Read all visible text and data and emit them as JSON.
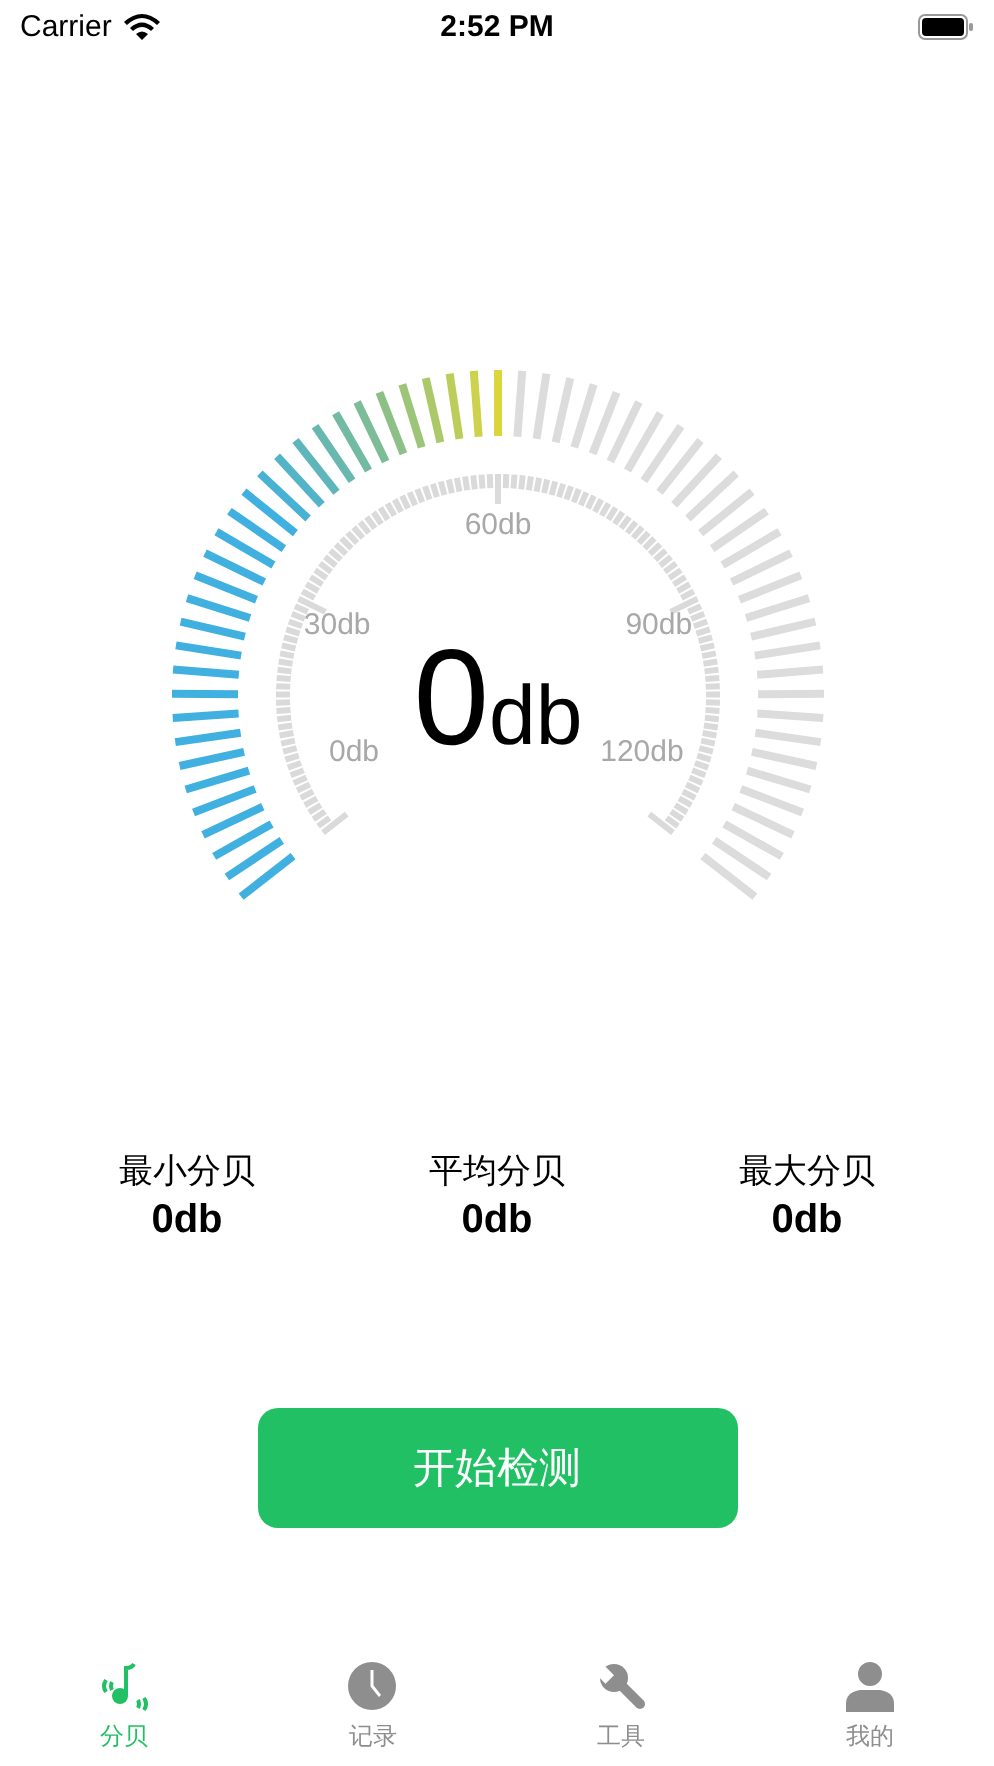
{
  "status_bar": {
    "carrier": "Carrier",
    "time": "2:52 PM"
  },
  "gauge": {
    "scale_labels": [
      "0db",
      "30db",
      "60db",
      "90db",
      "120db"
    ],
    "value": "0",
    "unit": "db"
  },
  "stats": [
    {
      "label": "最小分贝",
      "value": "0db"
    },
    {
      "label": "平均分贝",
      "value": "0db"
    },
    {
      "label": "最大分贝",
      "value": "0db"
    }
  ],
  "start_button": "开始检测",
  "tabs": [
    {
      "label": "分贝",
      "kind": "note",
      "selected": true
    },
    {
      "label": "记录",
      "kind": "clock",
      "selected": false
    },
    {
      "label": "工具",
      "kind": "wrench",
      "selected": false
    },
    {
      "label": "我的",
      "kind": "person",
      "selected": false
    }
  ]
}
